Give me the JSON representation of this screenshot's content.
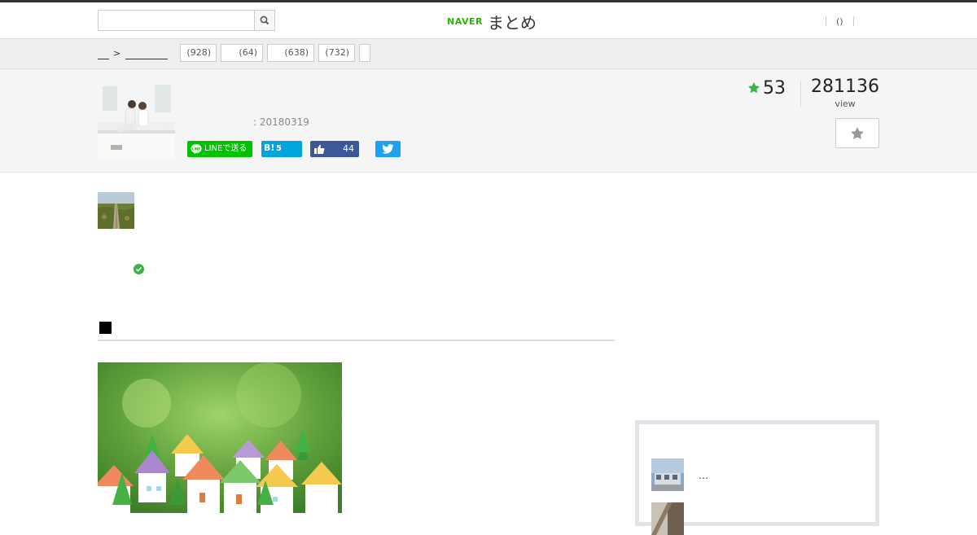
{
  "header": {
    "search_placeholder": "",
    "logo_naver": "NAVER",
    "logo_matome": "まとめ",
    "notification_count": "()"
  },
  "breadcrumb": {
    "arrow": ">",
    "tags": [
      {
        "count": "(928)"
      },
      {
        "count": "(64)"
      },
      {
        "count": "(638)"
      },
      {
        "count": "(732)"
      },
      {
        "count": ""
      }
    ]
  },
  "summary": {
    "date": ": 20180319",
    "favorites": "53",
    "views": "281136",
    "views_label": "view"
  },
  "share": {
    "line_label": "LINEで送る",
    "hatena_mark": "B!",
    "hatena_count": "5",
    "facebook_count": "44"
  },
  "sidebar": {
    "item1_text": "…"
  },
  "colors": {
    "naver_green": "#2db400",
    "line_green": "#00c300",
    "hatena_blue": "#00a4de",
    "facebook_blue": "#3b5998",
    "twitter_blue": "#1da1f2",
    "star_green": "#3db346"
  },
  "icons": [
    "search-icon",
    "line-icon",
    "like-icon",
    "twitter-icon",
    "star-icon",
    "check-icon"
  ]
}
